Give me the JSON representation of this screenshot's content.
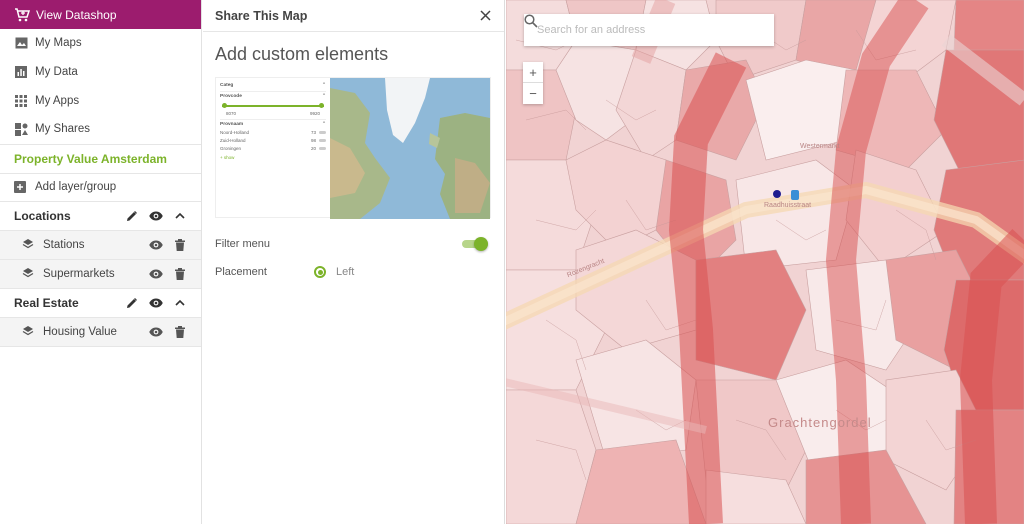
{
  "sidebar": {
    "datashop_label": "View Datashop",
    "nav": [
      {
        "label": "My Maps",
        "icon": "image-icon"
      },
      {
        "label": "My Data",
        "icon": "chart-icon"
      },
      {
        "label": "My Apps",
        "icon": "apps-grid-icon"
      },
      {
        "label": "My Shares",
        "icon": "shares-icon"
      }
    ],
    "map_title": "Property Value Amsterdam",
    "add_layer_label": "Add layer/group",
    "groups": [
      {
        "name": "Locations",
        "layers": [
          "Stations",
          "Supermarkets"
        ]
      },
      {
        "name": "Real Estate",
        "layers": [
          "Housing Value"
        ]
      }
    ]
  },
  "panel": {
    "title": "Share This Map",
    "section_title": "Add custom elements",
    "preview": {
      "sec1": "Categ",
      "sec2": "Provcode",
      "range_min": "8070",
      "range_max": "9920",
      "sec3": "Provnaam",
      "rows": [
        {
          "name": "Noord-Holland",
          "count": "73"
        },
        {
          "name": "Zuid-Holland",
          "count": "98"
        },
        {
          "name": "Groningen",
          "count": "20"
        }
      ],
      "link": "+ show"
    },
    "filter_menu_label": "Filter menu",
    "filter_menu_on": true,
    "placement_label": "Placement",
    "placement_value": "Left"
  },
  "map": {
    "search_placeholder": "Search for an address",
    "zoom_in": "+",
    "zoom_out": "−",
    "street_label": "Grachtengordel",
    "label_westermarkt": "Westermarkt",
    "label_rozengracht": "Rozengracht",
    "label_raadhuis": "Raadhuisstraat",
    "colors": {
      "light": "#f7e3e3",
      "mid": "#eeb7b7",
      "strong": "#e48585",
      "dark": "#d95858",
      "road": "#f8d9b4"
    }
  },
  "colors": {
    "brand": "#9c1c6e",
    "accent": "#7cb32a"
  }
}
